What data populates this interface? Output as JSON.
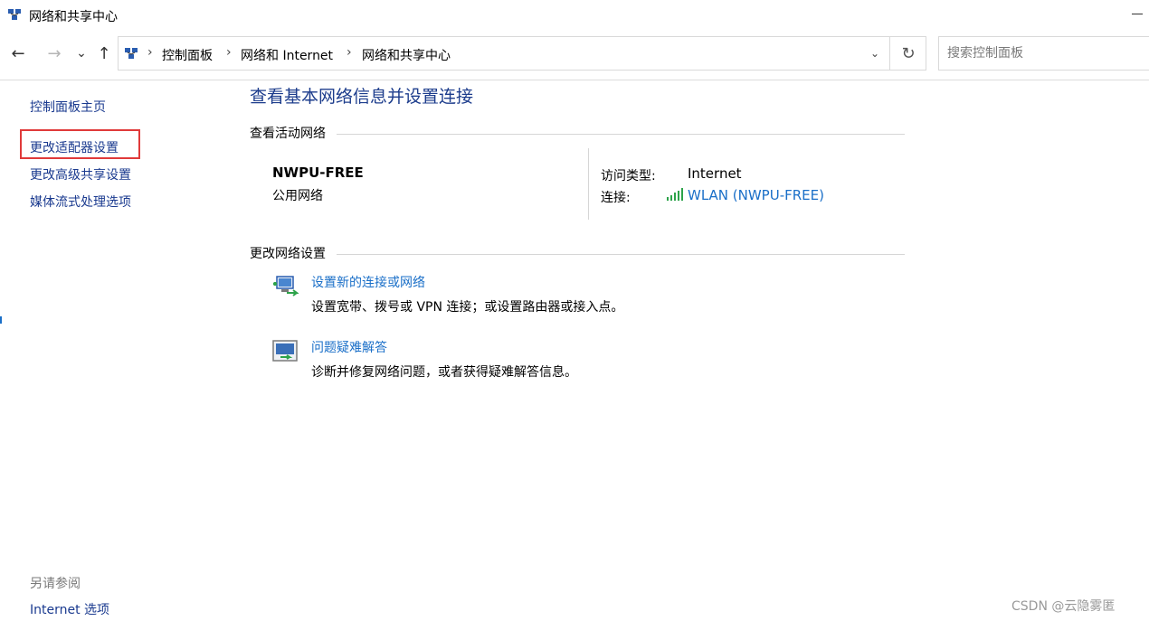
{
  "window": {
    "title": "网络和共享中心",
    "icon": "network-center-icon"
  },
  "navigation": {
    "back_icon": "←",
    "forward_icon": "→",
    "recent_icon": "⌄",
    "up_icon": "↑",
    "breadcrumbs": [
      "控制面板",
      "网络和 Internet",
      "网络和共享中心"
    ],
    "separator": "›",
    "dropdown_icon": "⌄",
    "refresh_icon": "↻",
    "search_placeholder": "搜索控制面板"
  },
  "sidebar": {
    "links": [
      "控制面板主页",
      "更改适配器设置",
      "更改高级共享设置",
      "媒体流式处理选项"
    ],
    "highlighted_index": 1,
    "see_also_label": "另请参阅",
    "see_also_links": [
      "Internet 选项"
    ]
  },
  "main": {
    "title": "查看基本网络信息并设置连接",
    "active_networks_header": "查看活动网络",
    "network": {
      "name": "NWPU-FREE",
      "type": "公用网络",
      "access_type_label": "访问类型:",
      "access_type_value": "Internet",
      "connection_label": "连接:",
      "connection_value": "WLAN (NWPU-FREE)",
      "signal_icon": "wifi-signal-icon"
    },
    "change_settings_header": "更改网络设置",
    "tasks": [
      {
        "link": "设置新的连接或网络",
        "description": "设置宽带、拨号或 VPN 连接；或设置路由器或接入点。",
        "icon": "new-connection-icon"
      },
      {
        "link": "问题疑难解答",
        "description": "诊断并修复网络问题，或者获得疑难解答信息。",
        "icon": "troubleshoot-icon"
      }
    ]
  },
  "watermark": "CSDN @云隐雾匿",
  "colors": {
    "link": "#1a6fc8",
    "sidebar_link": "#1a3a8f",
    "title": "#1c3c8c",
    "highlight": "#e03a3a",
    "signal": "#2da34a"
  }
}
